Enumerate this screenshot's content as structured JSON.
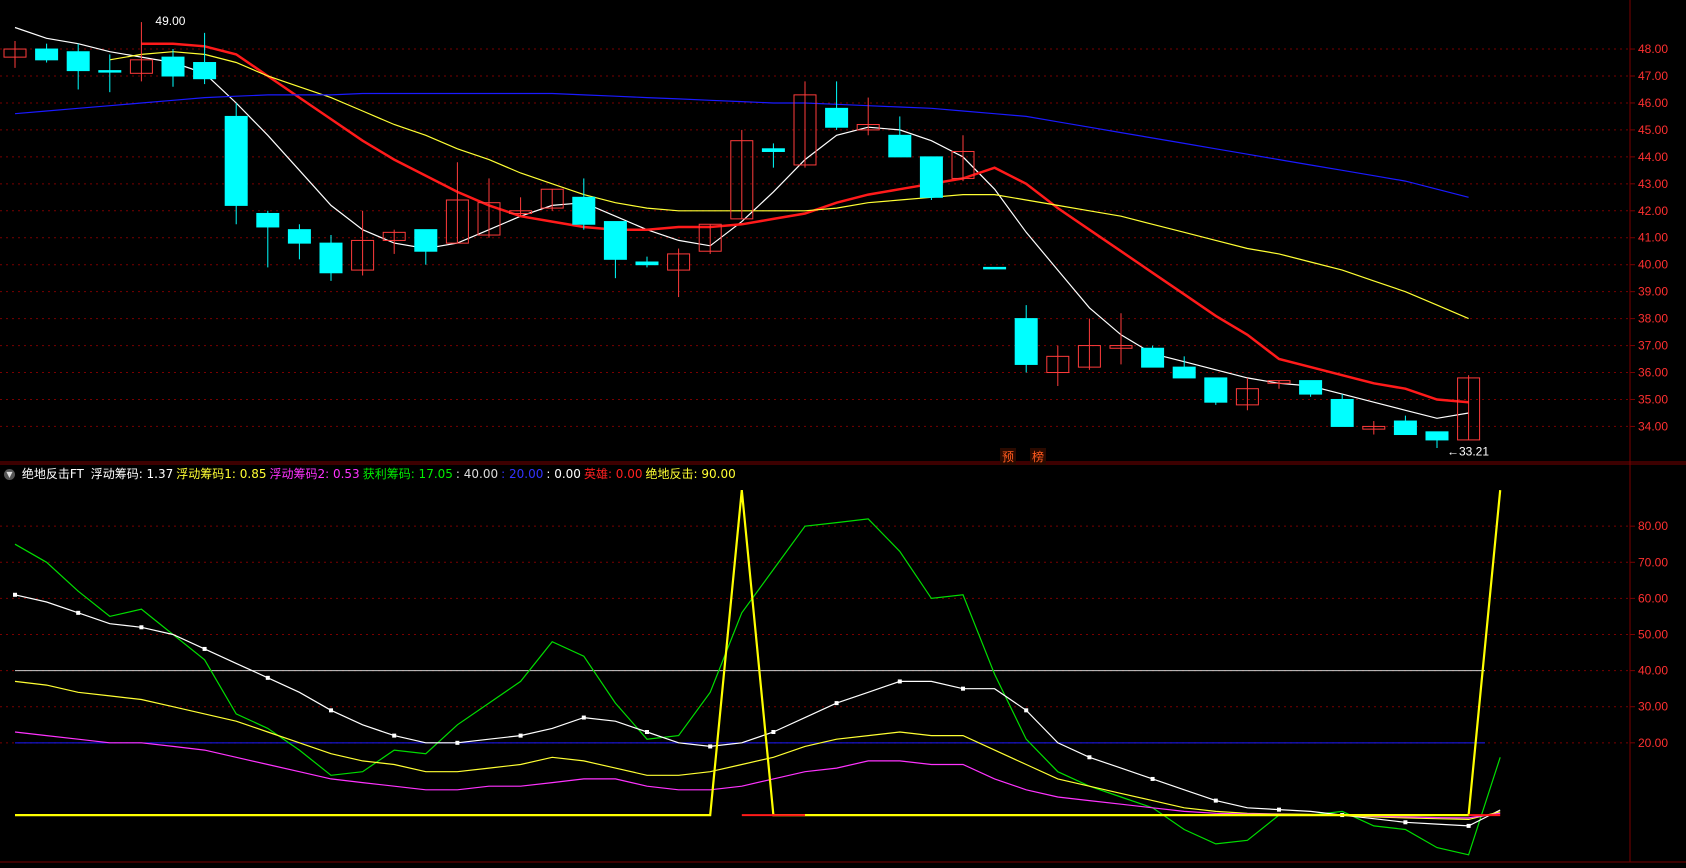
{
  "colors": {
    "background": "#000000",
    "grid": "#7a0000",
    "axis_text": "#ff3030",
    "up_candle": "#ff3b3b",
    "down_candle": "#00ffff",
    "ma5": "#ffffff",
    "ma10": "#ff1a1a",
    "ma20": "#ffff33",
    "ma60": "#1a1aff",
    "chip_total": "#ffffff",
    "chip1": "#ffff33",
    "chip2": "#ff33ff",
    "profit": "#00dd00",
    "signal": "#ffff00"
  },
  "tags": {
    "tag1": "预",
    "tag2": "榜"
  },
  "legend": {
    "name": "绝地反击FT",
    "items": [
      {
        "label": "浮动筹码:",
        "value": "1.37",
        "color": "#ffffff"
      },
      {
        "label": "浮动筹码1:",
        "value": "0.85",
        "color": "#ffff33"
      },
      {
        "label": "浮动筹码2:",
        "value": "0.53",
        "color": "#ff33ff"
      },
      {
        "label": "获利筹码:",
        "value": "17.05",
        "color": "#00ee00"
      },
      {
        "label": ":",
        "value": "40.00",
        "color": "#dddddd"
      },
      {
        "label": ":",
        "value": "20.00",
        "color": "#3333ff"
      },
      {
        "label": ":",
        "value": "0.00",
        "color": "#ffffff"
      },
      {
        "label": "英雄:",
        "value": "0.00",
        "color": "#ff2020"
      },
      {
        "label": "绝地反击:",
        "value": "90.00",
        "color": "#ffff33"
      }
    ]
  },
  "chart_data": [
    {
      "type": "candlestick",
      "ylim": [
        33.2,
        49.3
      ],
      "yticks": [
        "34.00",
        "35.00",
        "36.00",
        "37.00",
        "38.00",
        "39.00",
        "40.00",
        "41.00",
        "42.00",
        "43.00",
        "44.00",
        "45.00",
        "46.00",
        "47.00",
        "48.00"
      ],
      "annotations": [
        {
          "text": "49.00",
          "index": 4,
          "value": 49.0,
          "kind": "high"
        },
        {
          "text": "33.21",
          "index": 45,
          "value": 33.21,
          "kind": "low"
        }
      ],
      "ohlc": [
        [
          47.7,
          48.3,
          47.3,
          48.0
        ],
        [
          48.0,
          48.2,
          47.5,
          47.6
        ],
        [
          47.9,
          48.2,
          46.5,
          47.2
        ],
        [
          47.2,
          47.8,
          46.4,
          47.2
        ],
        [
          47.1,
          49.0,
          46.8,
          47.6
        ],
        [
          47.7,
          48.0,
          46.6,
          47.0
        ],
        [
          47.5,
          48.6,
          46.7,
          46.9
        ],
        [
          45.5,
          46.0,
          41.5,
          42.2
        ],
        [
          41.9,
          42.0,
          39.9,
          41.4
        ],
        [
          41.3,
          41.5,
          40.2,
          40.8
        ],
        [
          40.8,
          41.1,
          39.4,
          39.7
        ],
        [
          39.8,
          42.0,
          39.6,
          40.9
        ],
        [
          40.9,
          41.3,
          40.4,
          41.2
        ],
        [
          41.3,
          41.3,
          40.0,
          40.5
        ],
        [
          40.8,
          43.8,
          40.8,
          42.4
        ],
        [
          41.1,
          43.2,
          41.0,
          42.3
        ],
        [
          41.9,
          42.5,
          41.8,
          42.0
        ],
        [
          42.1,
          42.8,
          42.0,
          42.8
        ],
        [
          42.5,
          43.2,
          41.3,
          41.5
        ],
        [
          41.6,
          41.6,
          39.5,
          40.2
        ],
        [
          40.1,
          40.3,
          39.9,
          40.0
        ],
        [
          39.8,
          40.6,
          38.8,
          40.4
        ],
        [
          40.5,
          41.5,
          40.4,
          41.5
        ],
        [
          41.7,
          45.0,
          41.7,
          44.6
        ],
        [
          44.3,
          44.5,
          43.6,
          44.2
        ],
        [
          43.7,
          46.8,
          43.6,
          46.3
        ],
        [
          45.8,
          46.8,
          45.0,
          45.1
        ],
        [
          45.0,
          46.2,
          44.8,
          45.2
        ],
        [
          44.8,
          45.5,
          44.0,
          44.0
        ],
        [
          44.0,
          44.0,
          42.4,
          42.5
        ],
        [
          43.2,
          44.8,
          43.1,
          44.2
        ],
        [
          39.9,
          39.9,
          39.9,
          39.9
        ],
        [
          38.0,
          38.5,
          36.0,
          36.3
        ],
        [
          36.0,
          37.0,
          35.5,
          36.6
        ],
        [
          36.2,
          38.0,
          36.1,
          37.0
        ],
        [
          36.9,
          38.2,
          36.3,
          37.0
        ],
        [
          36.9,
          37.0,
          36.2,
          36.2
        ],
        [
          36.2,
          36.6,
          35.8,
          35.8
        ],
        [
          35.8,
          35.8,
          34.8,
          34.9
        ],
        [
          34.8,
          35.8,
          34.6,
          35.4
        ],
        [
          35.6,
          35.7,
          35.4,
          35.7
        ],
        [
          35.7,
          35.7,
          35.1,
          35.2
        ],
        [
          35.0,
          35.2,
          34.0,
          34.0
        ],
        [
          33.9,
          34.2,
          33.7,
          34.0
        ],
        [
          34.2,
          34.4,
          33.7,
          33.7
        ],
        [
          33.8,
          33.8,
          33.2,
          33.5
        ],
        [
          33.5,
          35.9,
          33.5,
          35.8
        ]
      ],
      "series": [
        {
          "key": "ma5",
          "values": [
            48.8,
            48.4,
            48.2,
            47.9,
            47.7,
            47.5,
            47.1,
            46.0,
            44.8,
            43.5,
            42.2,
            41.3,
            40.8,
            40.6,
            40.8,
            41.3,
            41.8,
            42.2,
            42.3,
            41.8,
            41.3,
            40.9,
            40.7,
            41.6,
            42.7,
            43.9,
            44.8,
            45.1,
            45.0,
            44.6,
            44.0,
            42.8,
            41.2,
            39.8,
            38.4,
            37.4,
            36.7,
            36.4,
            36.1,
            35.8,
            35.6,
            35.5,
            35.2,
            34.9,
            34.6,
            34.3,
            34.5
          ]
        },
        {
          "key": "ma10",
          "values": [
            null,
            null,
            null,
            null,
            48.2,
            48.2,
            48.1,
            47.8,
            47.0,
            46.2,
            45.4,
            44.6,
            43.9,
            43.3,
            42.7,
            42.2,
            41.8,
            41.6,
            41.4,
            41.3,
            41.3,
            41.4,
            41.4,
            41.5,
            41.7,
            41.9,
            42.3,
            42.6,
            42.8,
            43.0,
            43.2,
            43.6,
            43.0,
            42.1,
            41.3,
            40.5,
            39.7,
            38.9,
            38.1,
            37.4,
            36.5,
            36.2,
            35.9,
            35.6,
            35.4,
            35.0,
            34.9
          ]
        },
        {
          "key": "ma20",
          "values": [
            null,
            null,
            null,
            47.6,
            47.8,
            47.9,
            47.8,
            47.5,
            47.0,
            46.6,
            46.2,
            45.7,
            45.2,
            44.8,
            44.3,
            43.9,
            43.4,
            43.0,
            42.6,
            42.3,
            42.1,
            42.0,
            42.0,
            42.0,
            42.0,
            42.0,
            42.1,
            42.3,
            42.4,
            42.5,
            42.6,
            42.6,
            42.4,
            42.2,
            42.0,
            41.8,
            41.5,
            41.2,
            40.9,
            40.6,
            40.4,
            40.1,
            39.8,
            39.4,
            39.0,
            38.5,
            38.0
          ]
        },
        {
          "key": "ma60",
          "values": [
            45.6,
            45.7,
            45.8,
            45.9,
            46.0,
            46.1,
            46.2,
            46.25,
            46.3,
            46.3,
            46.3,
            46.35,
            46.35,
            46.35,
            46.35,
            46.35,
            46.35,
            46.35,
            46.3,
            46.25,
            46.2,
            46.15,
            46.1,
            46.05,
            46.0,
            46.0,
            45.95,
            45.9,
            45.85,
            45.8,
            45.7,
            45.6,
            45.5,
            45.3,
            45.1,
            44.9,
            44.7,
            44.5,
            44.3,
            44.1,
            43.9,
            43.7,
            43.5,
            43.3,
            43.1,
            42.8,
            42.5
          ]
        }
      ]
    },
    {
      "type": "line",
      "title": "绝地反击FT",
      "ylim": [
        -13,
        95
      ],
      "yticks": [
        "20.00",
        "30.00",
        "40.00",
        "50.00",
        "60.00",
        "70.00",
        "80.00"
      ],
      "hlines": [
        {
          "value": 40,
          "key": "chip_total"
        },
        {
          "value": 20,
          "key": "ma60"
        }
      ],
      "series": [
        {
          "key": "profit",
          "name": "获利筹码",
          "values": [
            75,
            70,
            62,
            55,
            57,
            50,
            43,
            28,
            24,
            18,
            11,
            12,
            18,
            17,
            25,
            31,
            37,
            48,
            44,
            31,
            21,
            22,
            34,
            56,
            68,
            80,
            81,
            82,
            73,
            60,
            61,
            39,
            21,
            12,
            8,
            5,
            2,
            -4,
            -8,
            -7,
            0,
            0,
            1,
            -3,
            -4,
            -9,
            -11,
            16
          ]
        },
        {
          "key": "chip_total",
          "name": "浮动筹码",
          "marked": true,
          "values": [
            61,
            59,
            56,
            53,
            52,
            50,
            46,
            42,
            38,
            34,
            29,
            25,
            22,
            20,
            20,
            21,
            22,
            24,
            27,
            26,
            23,
            20,
            19,
            20,
            23,
            27,
            31,
            34,
            37,
            37,
            35,
            35,
            29,
            20,
            16,
            13,
            10,
            7,
            4,
            2,
            1.5,
            1,
            0,
            -1,
            -2,
            -2.5,
            -3,
            1.4
          ]
        },
        {
          "key": "chip1",
          "name": "浮动筹码1",
          "values": [
            37,
            36,
            34,
            33,
            32,
            30,
            28,
            26,
            23,
            20,
            17,
            15,
            14,
            12,
            12,
            13,
            14,
            16,
            15,
            13,
            11,
            11,
            12,
            14,
            16,
            19,
            21,
            22,
            23,
            22,
            22,
            18,
            14,
            10,
            8,
            6,
            4,
            2,
            1,
            0.5,
            0.3,
            0.2,
            0,
            -0.5,
            -0.8,
            -1,
            -1.2,
            0.9
          ]
        },
        {
          "key": "chip2",
          "name": "浮动筹码2",
          "values": [
            23,
            22,
            21,
            20,
            20,
            19,
            18,
            16,
            14,
            12,
            10,
            9,
            8,
            7,
            7,
            8,
            8,
            9,
            10,
            10,
            8,
            7,
            7,
            8,
            10,
            12,
            13,
            15,
            15,
            14,
            14,
            10,
            7,
            5,
            4,
            3,
            2,
            1,
            0.5,
            0.3,
            0.2,
            0.1,
            0,
            -0.3,
            -0.5,
            -0.7,
            -0.8,
            0.5
          ]
        },
        {
          "key": "signal",
          "name": "绝地反击",
          "values": [
            0,
            0,
            0,
            0,
            0,
            0,
            0,
            0,
            0,
            0,
            0,
            0,
            0,
            0,
            0,
            0,
            0,
            0,
            0,
            0,
            0,
            0,
            0,
            90,
            0,
            0,
            0,
            0,
            0,
            0,
            0,
            0,
            0,
            0,
            0,
            0,
            0,
            0,
            0,
            0,
            0,
            0,
            0,
            0,
            0,
            0,
            0,
            90
          ]
        },
        {
          "key": "ma10",
          "name": "英雄",
          "values": [
            null,
            null,
            null,
            null,
            null,
            null,
            null,
            null,
            null,
            null,
            null,
            null,
            null,
            null,
            null,
            null,
            null,
            null,
            null,
            null,
            null,
            null,
            null,
            0,
            0,
            0,
            null,
            null,
            null,
            null,
            null,
            null,
            null,
            null,
            null,
            null,
            null,
            null,
            null,
            null,
            null,
            null,
            null,
            null,
            null,
            null,
            0,
            0
          ]
        }
      ]
    }
  ]
}
